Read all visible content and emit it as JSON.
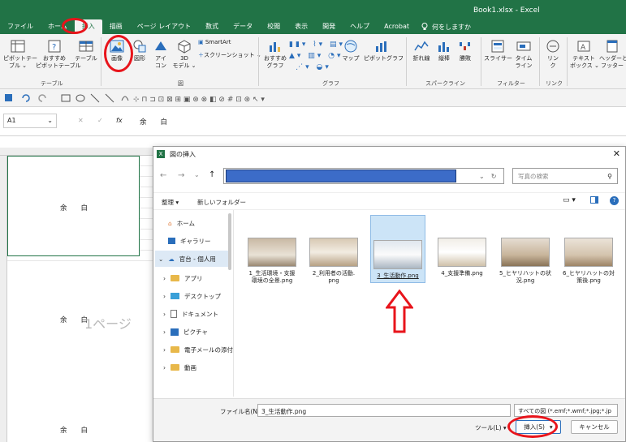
{
  "window": {
    "title": "Book1.xlsx  -  Excel"
  },
  "menu_tabs": [
    "ファイル",
    "ホーム",
    "挿入",
    "描画",
    "ページ レイアウト",
    "数式",
    "データ",
    "校閲",
    "表示",
    "開発",
    "ヘルプ",
    "Acrobat"
  ],
  "tell_me": "何をしますか",
  "ribbon": {
    "pivot": "ピボットテー\nブル ⌄",
    "rec_pivot": "おすすめ\nピボットテーブル",
    "table": "テーブル",
    "group_table": "テーブル",
    "image": "画像",
    "shapes": "図形",
    "icons": "アイ\nコン",
    "model3d": "3D\nモデル ⌄",
    "smartart": "SmartArt",
    "screenshot": "スクリーンショット ⌄",
    "group_figure": "図",
    "rec_chart": "おすすめ\nグラフ",
    "map": "マップ",
    "pivot_chart": "ピボットグラフ",
    "group_chart": "グラフ",
    "line": "折れ線",
    "column": "縦棒",
    "winloss": "勝敗",
    "group_spark": "スパークライン",
    "slicer": "スライサー",
    "timeline": "タイム\nライン",
    "group_filter": "フィルター",
    "link": "リン\nク",
    "group_link": "リンク",
    "textbox": "テキスト\nボックス ⌄",
    "header_footer": "ヘッダーと\nフッター"
  },
  "formula_bar": {
    "name_box": "A1",
    "fx": "fx",
    "content": "余　　白"
  },
  "sheet": {
    "blocks": [
      {
        "text": "余　　白"
      },
      {
        "text": "余　　白"
      },
      {
        "text": "余　　白"
      }
    ],
    "page_watermark": "1ページ"
  },
  "dialog": {
    "title": "図の挿入",
    "search_placeholder": "写真の検索",
    "organize": "整理 ▾",
    "new_folder": "新しいフォルダー",
    "nav_items": [
      {
        "label": "ホーム"
      },
      {
        "label": "ギャラリー"
      },
      {
        "label": "官台 - 個人用"
      },
      {
        "label": "アプリ"
      },
      {
        "label": "デスクトップ"
      },
      {
        "label": "ドキュメント"
      },
      {
        "label": "ピクチャ"
      },
      {
        "label": "電子メールの添付"
      },
      {
        "label": "動画"
      }
    ],
    "files": [
      {
        "name": "1_生活環境・支援\n環境の全景.png"
      },
      {
        "name": "2_利用者の活動.\npng"
      },
      {
        "name": "3_生活動作.png"
      },
      {
        "name": "4_支援準備.png"
      },
      {
        "name": "5_ヒヤリハットの状\n況.png"
      },
      {
        "name": "6_ヒヤリハットの対\n策後.png"
      }
    ],
    "filename_label": "ファイル名(N):",
    "filename_value": "3_生活動作.png",
    "filetype": "すべての図 (*.emf;*.wmf;*.jpg;*.jp",
    "tools": "ツール(L)",
    "insert": "挿入(S)",
    "cancel": "キャンセル"
  },
  "colors": {
    "excel_green": "#217346",
    "address_fill": "#3c6cc8",
    "annotation_red": "#e8141b",
    "selected_tile": "#cce4f7"
  }
}
